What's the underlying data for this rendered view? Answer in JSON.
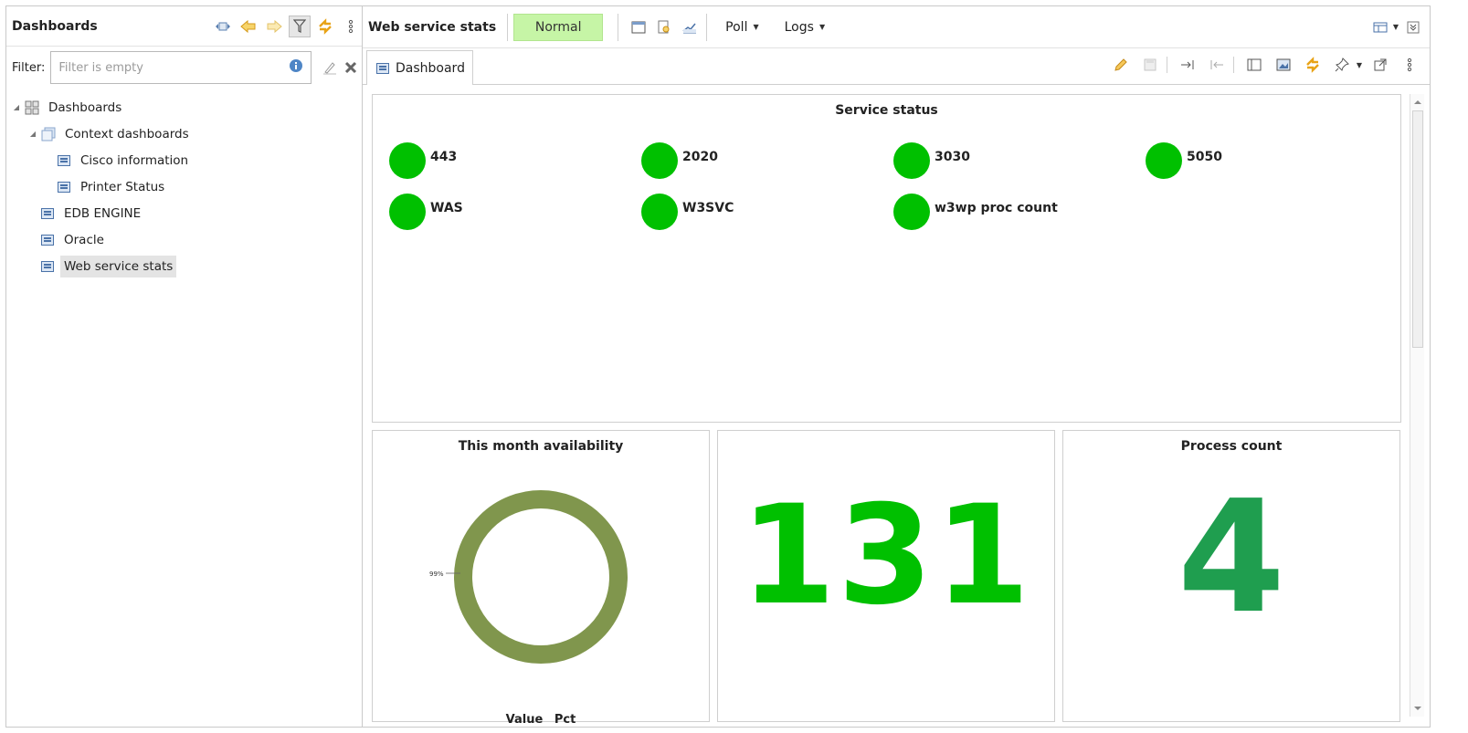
{
  "left": {
    "title": "Dashboards",
    "filter_label": "Filter:",
    "filter_placeholder": "Filter is empty",
    "tree": {
      "root": "Dashboards",
      "context": "Context dashboards",
      "context_children": [
        "Cisco information",
        "Printer Status"
      ],
      "items": [
        "EDB ENGINE",
        "Oracle",
        "Web service stats"
      ]
    }
  },
  "toolbar": {
    "object_name": "Web service stats",
    "status": "Normal",
    "menus": [
      "Poll",
      "Logs"
    ]
  },
  "tab": {
    "label": "Dashboard"
  },
  "service_status": {
    "title": "Service status",
    "services": [
      {
        "name": "443",
        "status_color": "#00c000"
      },
      {
        "name": "2020",
        "status_color": "#00c000"
      },
      {
        "name": "3030",
        "status_color": "#00c000"
      },
      {
        "name": "5050",
        "status_color": "#00c000"
      },
      {
        "name": "WAS",
        "status_color": "#00c000"
      },
      {
        "name": "W3SVC",
        "status_color": "#00c000"
      },
      {
        "name": "w3wp proc count",
        "status_color": "#00c000"
      }
    ]
  },
  "availability": {
    "title": "This month availability",
    "ring_label": "99%",
    "legend": [
      "Value",
      "Pct"
    ],
    "ring_color": "#80964d"
  },
  "big_value": {
    "value": "131",
    "color": "#00c000"
  },
  "process_count": {
    "title": "Process count",
    "value": "4",
    "color": "#1f9e4f"
  }
}
